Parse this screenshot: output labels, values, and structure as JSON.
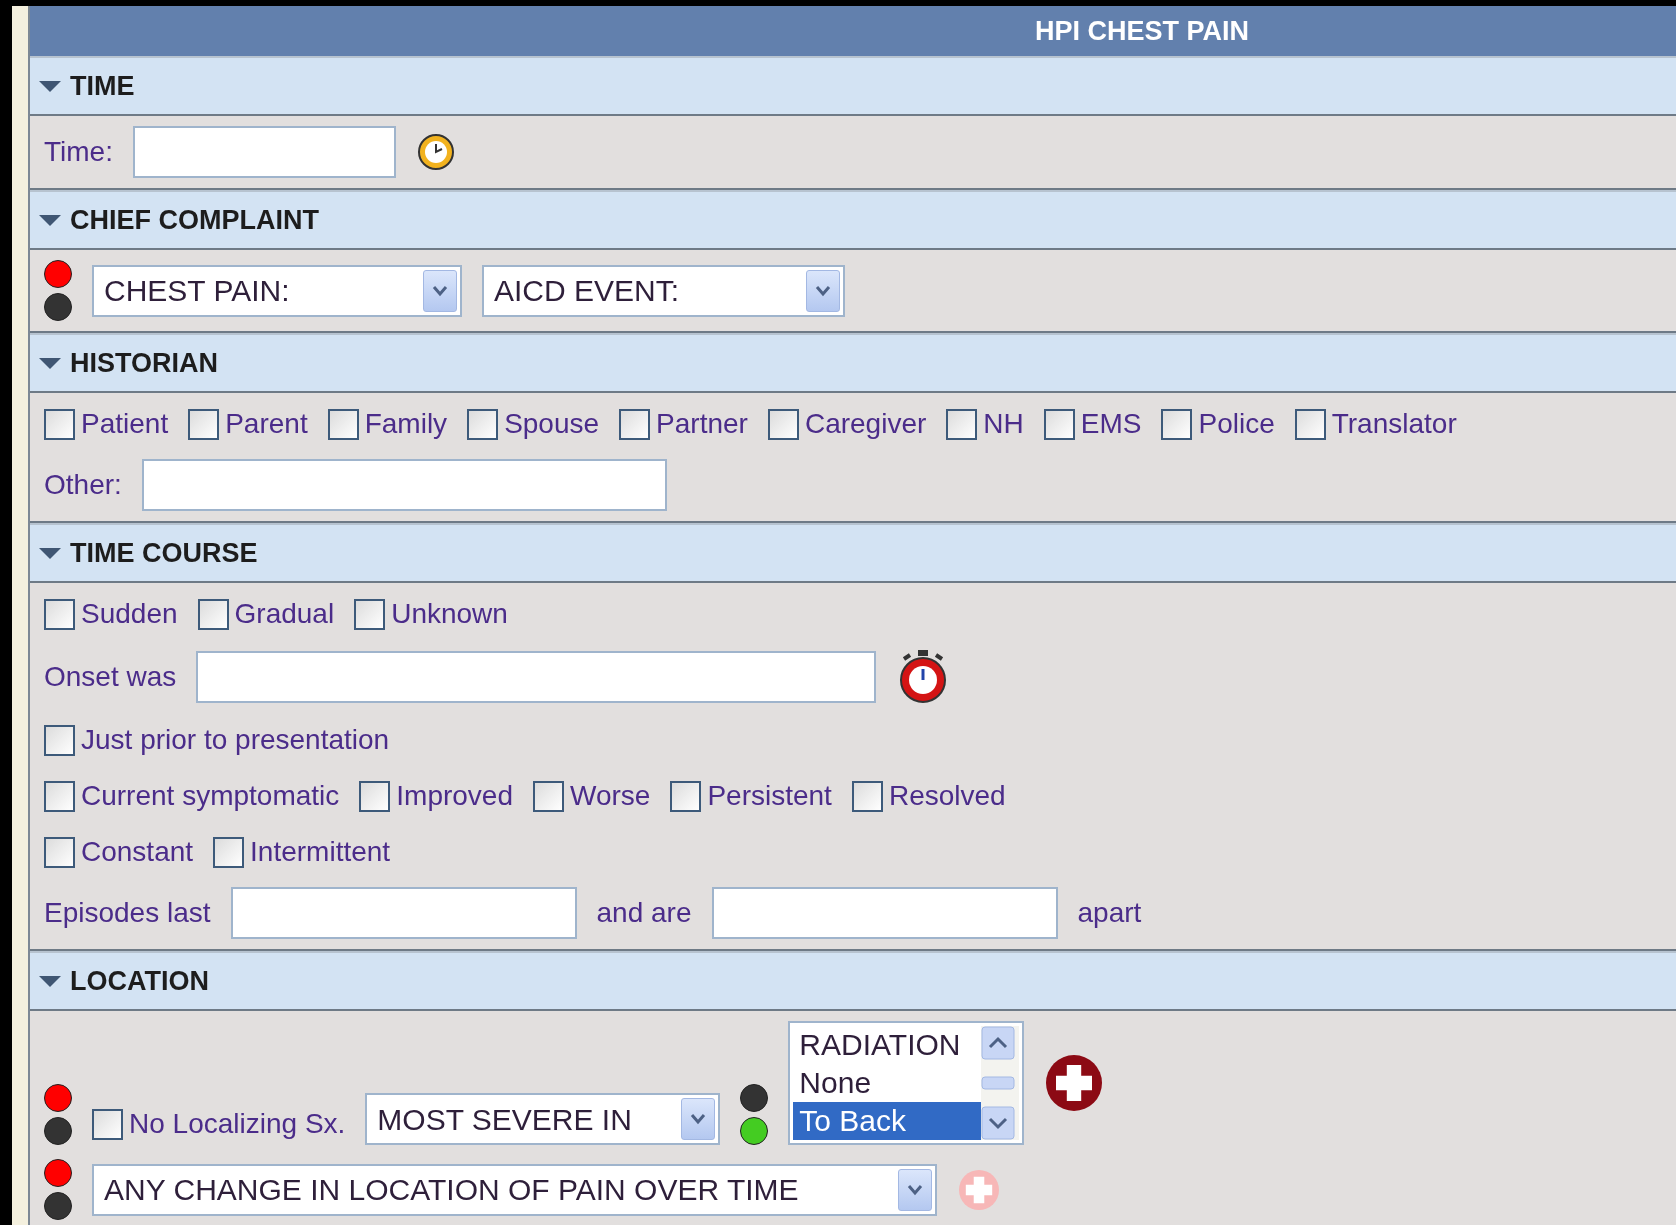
{
  "title": "HPI CHEST PAIN",
  "sections": [
    {
      "heading": "TIME",
      "expanded": true,
      "rows": [
        [
          {
            "kind": "label",
            "text": "Time:"
          },
          {
            "kind": "field"
          },
          {
            "kind": "clock"
          }
        ]
      ]
    },
    {
      "heading": "CHIEF COMPLAINT",
      "expanded": true,
      "rows": [
        [
          {
            "kind": "lights",
            "lamps": [
              {
                "color": "#ff0000"
              },
              {
                "color": "#333333"
              }
            ]
          },
          {
            "kind": "select",
            "value": "CHEST PAIN:"
          },
          {
            "kind": "select",
            "value": "AICD EVENT:"
          }
        ]
      ]
    },
    {
      "heading": "HISTORIAN",
      "expanded": true,
      "rows": [
        [
          {
            "kind": "check",
            "label": "Patient",
            "checked": false
          },
          {
            "kind": "check",
            "label": "Parent",
            "checked": false
          },
          {
            "kind": "check",
            "label": "Family",
            "checked": false
          },
          {
            "kind": "check",
            "label": "Spouse",
            "checked": false
          },
          {
            "kind": "check",
            "label": "Partner",
            "checked": false
          },
          {
            "kind": "check",
            "label": "Caregiver",
            "checked": false
          },
          {
            "kind": "check",
            "label": "NH",
            "checked": false
          },
          {
            "kind": "check",
            "label": "EMS",
            "checked": false
          },
          {
            "kind": "check",
            "label": "Police",
            "checked": false
          },
          {
            "kind": "check",
            "label": "Translator",
            "checked": false
          }
        ],
        [
          {
            "kind": "label",
            "text": "Other:"
          },
          {
            "kind": "field"
          }
        ]
      ]
    },
    {
      "heading": "TIME COURSE",
      "expanded": true,
      "rows": [
        [
          {
            "kind": "check",
            "label": "Sudden",
            "checked": false
          },
          {
            "kind": "check",
            "label": "Gradual",
            "checked": false
          },
          {
            "kind": "check",
            "label": "Unknown",
            "checked": false
          }
        ],
        [
          {
            "kind": "label",
            "text": "Onset was"
          },
          {
            "kind": "field"
          },
          {
            "kind": "stopwatch"
          }
        ],
        [
          {
            "kind": "check",
            "label": "Just prior to presentation",
            "checked": false
          }
        ],
        [
          {
            "kind": "check",
            "label": "Current symptomatic",
            "checked": false
          },
          {
            "kind": "check",
            "label": "Improved",
            "checked": false
          },
          {
            "kind": "check",
            "label": "Worse",
            "checked": false
          },
          {
            "kind": "check",
            "label": "Persistent",
            "checked": false
          },
          {
            "kind": "check",
            "label": "Resolved",
            "checked": false
          }
        ],
        [
          {
            "kind": "check",
            "label": "Constant",
            "checked": false
          },
          {
            "kind": "check",
            "label": "Intermittent",
            "checked": false
          }
        ],
        [
          {
            "kind": "label",
            "text": "Episodes last"
          },
          {
            "kind": "field"
          },
          {
            "kind": "label",
            "text": "and are"
          },
          {
            "kind": "field"
          },
          {
            "kind": "label",
            "text": "apart"
          }
        ]
      ]
    },
    {
      "heading": "LOCATION",
      "expanded": true,
      "rows": [
        [
          {
            "kind": "lights",
            "lamps": [
              {
                "color": "#ff0000"
              },
              {
                "color": "#333333"
              }
            ]
          },
          {
            "kind": "check",
            "label": "No Localizing Sx.",
            "checked": false
          },
          {
            "kind": "select",
            "value": "MOST SEVERE IN"
          },
          {
            "kind": "lights",
            "lamps": [
              {
                "color": "#333333"
              },
              {
                "color": "#44cc22"
              }
            ]
          },
          {
            "kind": "listbox",
            "items": [
              {
                "text": "RADIATION",
                "selected": false
              },
              {
                "text": "None",
                "selected": false
              },
              {
                "text": "To Back",
                "selected": true
              }
            ]
          },
          {
            "kind": "add",
            "disabled": false
          }
        ],
        [
          {
            "kind": "lights",
            "lamps": [
              {
                "color": "#ff0000"
              },
              {
                "color": "#333333"
              }
            ]
          },
          {
            "kind": "select",
            "value": "ANY CHANGE IN LOCATION OF PAIN OVER TIME"
          },
          {
            "kind": "add",
            "disabled": true
          }
        ]
      ]
    }
  ]
}
